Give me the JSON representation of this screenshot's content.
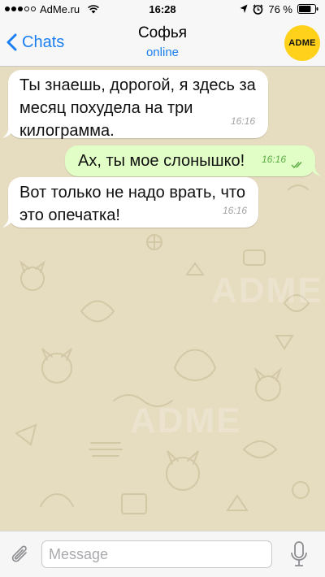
{
  "status_bar": {
    "carrier": "AdMe.ru",
    "time": "16:28",
    "battery_percent": "76 %",
    "signal_bars_filled": 3,
    "signal_bars_total": 5,
    "battery_level": 0.76
  },
  "nav": {
    "back_label": "Chats",
    "title": "Софья",
    "status": "online",
    "avatar_text": "ADME"
  },
  "messages": [
    {
      "direction": "incoming",
      "lines": [
        "Ты знаешь, дорогой, я здесь за",
        "месяц похудела на три",
        "килограмма."
      ],
      "time": "16:16"
    },
    {
      "direction": "outgoing",
      "lines": [
        "Ах, ты мое слонышко!"
      ],
      "time": "16:16",
      "read": true
    },
    {
      "direction": "incoming",
      "lines": [
        "Вот только не надо врать, что",
        "это опечатка!"
      ],
      "time": "16:16"
    }
  ],
  "input": {
    "placeholder": "Message",
    "value": ""
  },
  "watermark": "ADME",
  "colors": {
    "background": "#e6dcc0",
    "accent": "#1a7ff0",
    "outgoing_bubble": "#e1fec6",
    "incoming_bubble": "#ffffff",
    "avatar": "#ffd11a",
    "read_check": "#5bae45"
  },
  "icons": [
    "wifi-icon",
    "location-arrow-icon",
    "alarm-icon",
    "battery-icon",
    "chevron-left-icon",
    "double-check-icon",
    "paperclip-icon",
    "microphone-icon"
  ]
}
